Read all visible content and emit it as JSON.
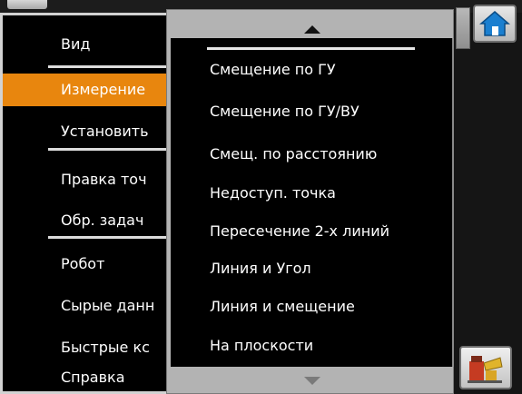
{
  "main_menu": {
    "items": [
      {
        "label": "Вид"
      },
      {
        "label": "Измерение"
      },
      {
        "label": "Установить"
      },
      {
        "label": "Правка точ"
      },
      {
        "label": "Обр. задач"
      },
      {
        "label": "Робот"
      },
      {
        "label": "Сырые данн"
      },
      {
        "label": "Быстрые кс"
      },
      {
        "label": "Справка"
      }
    ],
    "selected_index": 1
  },
  "submenu": {
    "items": [
      {
        "label": "Смещение по ГУ"
      },
      {
        "label": "Смещение по ГУ/ВУ"
      },
      {
        "label": "Смещ. по расстоянию"
      },
      {
        "label": "Недоступ. точка"
      },
      {
        "label": "Пересечение 2-х линий"
      },
      {
        "label": "Линия и Угол"
      },
      {
        "label": "Линия и смещение"
      },
      {
        "label": "На плоскости"
      }
    ]
  },
  "icons": {
    "home": "home-icon",
    "robot": "robot-icon",
    "scroll_up": "chevron-up-icon",
    "scroll_down": "chevron-down-icon"
  },
  "colors": {
    "selected": "#e8860e",
    "menu_bg": "#000000",
    "frame": "#b3b3b3",
    "home_roof": "#1a7fd0"
  }
}
